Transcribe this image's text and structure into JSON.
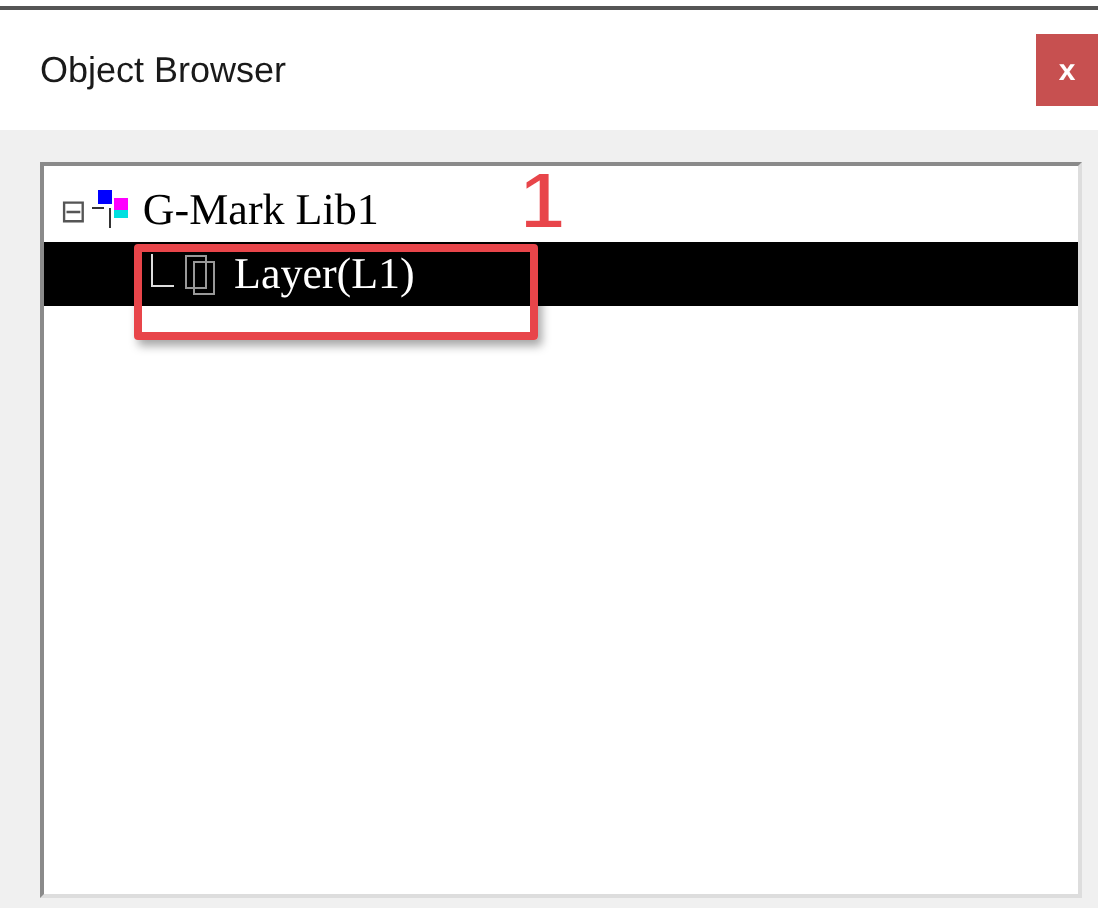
{
  "window": {
    "title": "Object Browser",
    "close": "x"
  },
  "tree": [
    {
      "label": "G-Mark Lib1",
      "kind": "library",
      "expanded": true,
      "selected": false,
      "expander": "⊟",
      "children": [
        {
          "label": "Layer(L1)",
          "kind": "layer",
          "selected": true
        }
      ]
    }
  ],
  "annotation": {
    "label": "1"
  }
}
